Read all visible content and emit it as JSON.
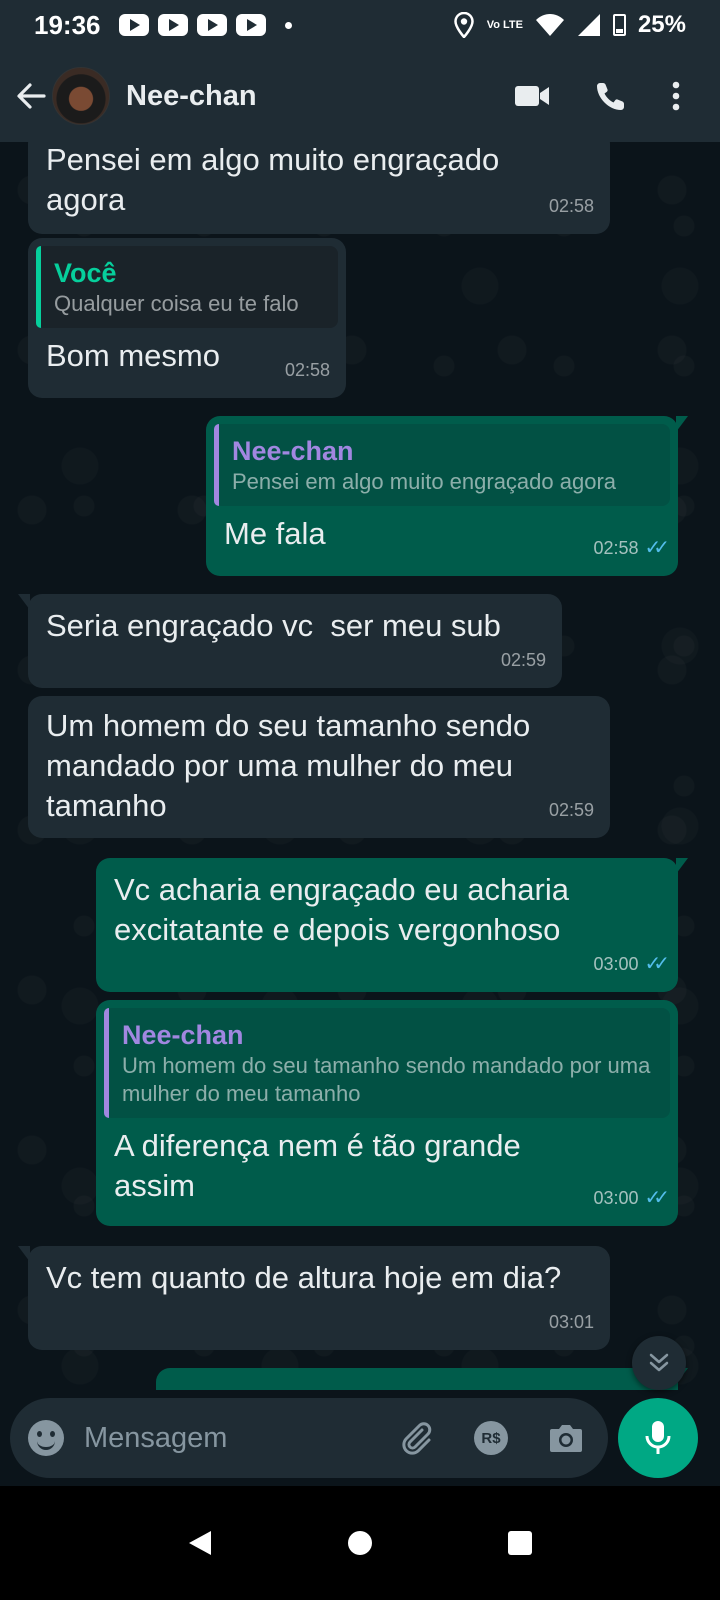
{
  "status_bar": {
    "time": "19:36",
    "network": "Vo LTE",
    "battery": "25%"
  },
  "header": {
    "contact_name": "Nee-chan",
    "icons": [
      "back-arrow-icon",
      "video-call-icon",
      "phone-icon",
      "more-vert-icon"
    ]
  },
  "messages": [
    {
      "direction": "in",
      "text": "Pensei em algo muito engraçado agora",
      "time": "02:58"
    },
    {
      "direction": "in",
      "quote": {
        "name": "Você",
        "text": "Qualquer coisa eu te falo"
      },
      "text": "Bom mesmo",
      "time": "02:58"
    },
    {
      "direction": "out",
      "quote": {
        "name": "Nee-chan",
        "text": "Pensei em algo muito engraçado agora"
      },
      "text": "Me fala",
      "time": "02:58"
    },
    {
      "direction": "in",
      "text": "Seria engraçado vc  ser meu sub",
      "time": "02:59"
    },
    {
      "direction": "in",
      "text": "Um homem do seu tamanho sendo mandado por uma mulher do meu tamanho",
      "time": "02:59"
    },
    {
      "direction": "out",
      "text": "Vc acharia engraçado eu acharia excitatante e depois vergonhoso",
      "time": "03:00"
    },
    {
      "direction": "out",
      "quote": {
        "name": "Nee-chan",
        "text": "Um homem do seu tamanho sendo mandado por uma mulher do meu tamanho"
      },
      "text": "A diferença nem é tão grande assim",
      "time": "03:00"
    },
    {
      "direction": "in",
      "text": "Vc tem quanto de altura hoje em dia?",
      "time": "03:01"
    }
  ],
  "composer": {
    "placeholder": "Mensagem",
    "currency_label": "R$"
  },
  "colors": {
    "incoming_bubble": "#1f2c34",
    "outgoing_bubble": "#005c4b",
    "accent_green": "#00a884",
    "quote_you": "#06cf9c",
    "quote_her": "#a187e0",
    "read_ticks": "#53bdeb"
  }
}
